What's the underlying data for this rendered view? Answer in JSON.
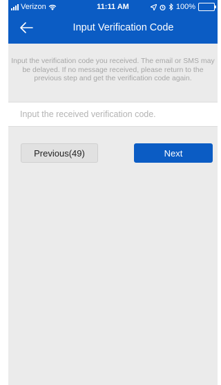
{
  "status_bar": {
    "carrier": "Verizon",
    "time": "11:11 AM",
    "battery": "100%",
    "icons": [
      "signal-icon",
      "wifi-icon",
      "location-icon",
      "alarm-icon",
      "bluetooth-icon",
      "battery-icon"
    ]
  },
  "header": {
    "title": "Input Verification Code",
    "back_icon": "back-arrow-icon"
  },
  "notice": {
    "text": "Input the verification code you received. The email or SMS may be delayed. If no message received, please return to the previous step and get the verification code again."
  },
  "code_input": {
    "value": "",
    "placeholder": "Input the received verification code."
  },
  "buttons": {
    "previous_label": "Previous(49)",
    "next_label": "Next"
  },
  "colors": {
    "brand": "#0b5cc4",
    "background": "#ebebeb",
    "hint_text": "#a6a6a6"
  }
}
